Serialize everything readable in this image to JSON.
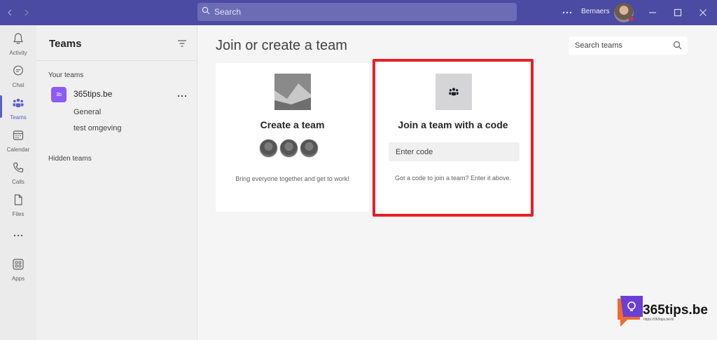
{
  "titlebar": {
    "search_placeholder": "Search",
    "user_name": "Bernaers",
    "more_label": "···"
  },
  "appbar": {
    "items": [
      {
        "label": "Activity",
        "icon": "bell-icon"
      },
      {
        "label": "Chat",
        "icon": "chat-icon"
      },
      {
        "label": "Teams",
        "icon": "teams-icon",
        "active": true
      },
      {
        "label": "Calendar",
        "icon": "calendar-icon"
      },
      {
        "label": "Calls",
        "icon": "phone-icon"
      },
      {
        "label": "Files",
        "icon": "file-icon"
      },
      {
        "label": "",
        "icon": "more-icon"
      },
      {
        "label": "Apps",
        "icon": "apps-icon"
      }
    ]
  },
  "teams_pane": {
    "title": "Teams",
    "your_teams_label": "Your teams",
    "team": {
      "initials": "3b",
      "name": "365tips.be"
    },
    "channels": [
      "General",
      "test omgeving"
    ],
    "hidden_teams_label": "Hidden teams"
  },
  "main": {
    "title": "Join or create a team",
    "search_placeholder": "Search teams",
    "create_card": {
      "title": "Create a team",
      "description": "Bring everyone together and get to work!"
    },
    "join_card": {
      "title": "Join a team with a code",
      "code_placeholder": "Enter code",
      "description": "Got a code to join a team? Enter it above."
    }
  },
  "watermark": {
    "text": "365tips.be",
    "subtext": "https://365tips.be/nl"
  },
  "colors": {
    "titlebar": "#4b4ba3",
    "accent": "#5b5fc7",
    "highlight_border": "#e3212a",
    "team_tile": "#8b5cf6"
  }
}
